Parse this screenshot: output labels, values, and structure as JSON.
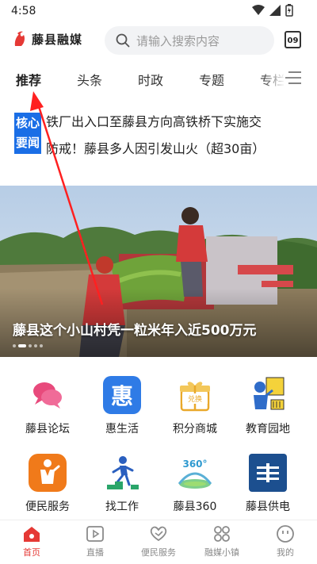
{
  "status_bar": {
    "time": "4:58"
  },
  "header": {
    "logo_text": "藤县融媒",
    "search_placeholder": "请输入搜索内容",
    "calendar_day": "09"
  },
  "tabs": [
    {
      "label": "推荐",
      "active": true
    },
    {
      "label": "头条",
      "active": false
    },
    {
      "label": "时政",
      "active": false
    },
    {
      "label": "专题",
      "active": false
    },
    {
      "label": "专栏",
      "active": false
    }
  ],
  "news_ticker": {
    "badge_line1": "核心",
    "badge_line2": "要闻",
    "line1": "铁厂出入口至藤县方向高铁桥下实施交",
    "line2": "防戒！藤县多人因引发山火（超30亩）"
  },
  "banner": {
    "caption": "藤县这个小山村凭一粒米年入近500万元",
    "dots_total": 5,
    "dots_active_index": 1
  },
  "services": [
    {
      "label": "藤县论坛",
      "icon": "forum-icon"
    },
    {
      "label": "惠生活",
      "icon": "hui-life-icon",
      "glyph": "惠"
    },
    {
      "label": "积分商城",
      "icon": "gift-icon",
      "glyph": "兑换"
    },
    {
      "label": "教育园地",
      "icon": "education-icon"
    },
    {
      "label": "便民服务",
      "icon": "service-person-icon"
    },
    {
      "label": "找工作",
      "icon": "job-runner-icon"
    },
    {
      "label": "藤县360",
      "icon": "360-icon",
      "glyph": "360°"
    },
    {
      "label": "藤县供电",
      "icon": "power-supply-icon"
    }
  ],
  "bottom_nav": [
    {
      "label": "首页",
      "icon": "home-icon",
      "active": true
    },
    {
      "label": "直播",
      "icon": "live-play-icon",
      "active": false
    },
    {
      "label": "便民服务",
      "icon": "heart-hands-icon",
      "active": false
    },
    {
      "label": "融媒小镇",
      "icon": "town-grid-icon",
      "active": false
    },
    {
      "label": "我的",
      "icon": "smile-icon",
      "active": false
    }
  ],
  "colors": {
    "accent_red": "#e53935",
    "badge_blue": "#1a6ee6",
    "search_bg": "#f2f3f5"
  }
}
